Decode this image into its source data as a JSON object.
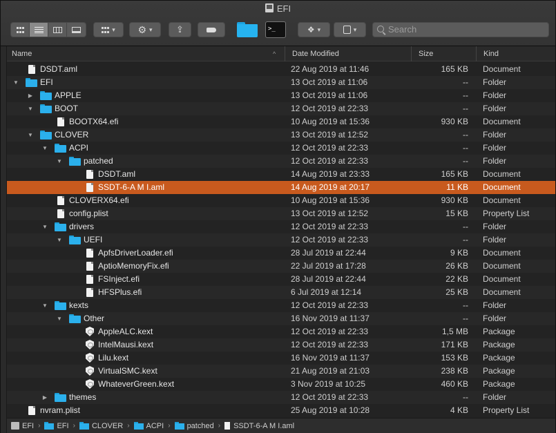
{
  "window": {
    "title": "EFI"
  },
  "toolbar": {
    "view_modes": [
      "icon-view",
      "list-view",
      "column-view",
      "gallery-view"
    ],
    "selected_view": "list-view",
    "search_placeholder": "Search"
  },
  "columns": {
    "name": "Name",
    "date": "Date Modified",
    "size": "Size",
    "kind": "Kind"
  },
  "rows": [
    {
      "level": 0,
      "disclosure": "",
      "icon": "document",
      "name": "DSDT.aml",
      "date": "22 Aug 2019 at 11:46",
      "size": "165 KB",
      "kind": "Document"
    },
    {
      "level": 0,
      "disclosure": "open",
      "icon": "folder",
      "name": "EFI",
      "date": "13 Oct 2019 at 11:06",
      "size": "--",
      "kind": "Folder"
    },
    {
      "level": 1,
      "disclosure": "closed",
      "icon": "folder",
      "name": "APPLE",
      "date": "13 Oct 2019 at 11:06",
      "size": "--",
      "kind": "Folder"
    },
    {
      "level": 1,
      "disclosure": "open",
      "icon": "folder",
      "name": "BOOT",
      "date": "12 Oct 2019 at 22:33",
      "size": "--",
      "kind": "Folder"
    },
    {
      "level": 2,
      "disclosure": "",
      "icon": "document",
      "name": "BOOTX64.efi",
      "date": "10 Aug 2019 at 15:36",
      "size": "930 KB",
      "kind": "Document"
    },
    {
      "level": 1,
      "disclosure": "open",
      "icon": "folder",
      "name": "CLOVER",
      "date": "13 Oct 2019 at 12:52",
      "size": "--",
      "kind": "Folder"
    },
    {
      "level": 2,
      "disclosure": "open",
      "icon": "folder",
      "name": "ACPI",
      "date": "12 Oct 2019 at 22:33",
      "size": "--",
      "kind": "Folder"
    },
    {
      "level": 3,
      "disclosure": "open",
      "icon": "folder",
      "name": "patched",
      "date": "12 Oct 2019 at 22:33",
      "size": "--",
      "kind": "Folder"
    },
    {
      "level": 4,
      "disclosure": "",
      "icon": "document",
      "name": "DSDT.aml",
      "date": "14 Aug 2019 at 23:33",
      "size": "165 KB",
      "kind": "Document"
    },
    {
      "level": 4,
      "disclosure": "",
      "icon": "document",
      "name": "SSDT-6-A M I.aml",
      "date": "14 Aug 2019 at 20:17",
      "size": "11 KB",
      "kind": "Document",
      "selected": true
    },
    {
      "level": 2,
      "disclosure": "",
      "icon": "document",
      "name": "CLOVERX64.efi",
      "date": "10 Aug 2019 at 15:36",
      "size": "930 KB",
      "kind": "Document"
    },
    {
      "level": 2,
      "disclosure": "",
      "icon": "document",
      "name": "config.plist",
      "date": "13 Oct 2019 at 12:52",
      "size": "15 KB",
      "kind": "Property List"
    },
    {
      "level": 2,
      "disclosure": "open",
      "icon": "folder",
      "name": "drivers",
      "date": "12 Oct 2019 at 22:33",
      "size": "--",
      "kind": "Folder"
    },
    {
      "level": 3,
      "disclosure": "open",
      "icon": "folder",
      "name": "UEFI",
      "date": "12 Oct 2019 at 22:33",
      "size": "--",
      "kind": "Folder"
    },
    {
      "level": 4,
      "disclosure": "",
      "icon": "document",
      "name": "ApfsDriverLoader.efi",
      "date": "28 Jul 2019 at 22:44",
      "size": "9 KB",
      "kind": "Document"
    },
    {
      "level": 4,
      "disclosure": "",
      "icon": "document",
      "name": "AptioMemoryFix.efi",
      "date": "22 Jul 2019 at 17:28",
      "size": "26 KB",
      "kind": "Document"
    },
    {
      "level": 4,
      "disclosure": "",
      "icon": "document",
      "name": "FSInject.efi",
      "date": "28 Jul 2019 at 22:44",
      "size": "22 KB",
      "kind": "Document"
    },
    {
      "level": 4,
      "disclosure": "",
      "icon": "document",
      "name": "HFSPlus.efi",
      "date": "6 Jul 2019 at 12:14",
      "size": "25 KB",
      "kind": "Document"
    },
    {
      "level": 2,
      "disclosure": "open",
      "icon": "folder",
      "name": "kexts",
      "date": "12 Oct 2019 at 22:33",
      "size": "--",
      "kind": "Folder"
    },
    {
      "level": 3,
      "disclosure": "open",
      "icon": "folder",
      "name": "Other",
      "date": "16 Nov 2019 at 11:37",
      "size": "--",
      "kind": "Folder"
    },
    {
      "level": 4,
      "disclosure": "",
      "icon": "kext",
      "name": "AppleALC.kext",
      "date": "12 Oct 2019 at 22:33",
      "size": "1,5 MB",
      "kind": "Package"
    },
    {
      "level": 4,
      "disclosure": "",
      "icon": "kext",
      "name": "IntelMausi.kext",
      "date": "12 Oct 2019 at 22:33",
      "size": "171 KB",
      "kind": "Package"
    },
    {
      "level": 4,
      "disclosure": "",
      "icon": "kext",
      "name": "Lilu.kext",
      "date": "16 Nov 2019 at 11:37",
      "size": "153 KB",
      "kind": "Package"
    },
    {
      "level": 4,
      "disclosure": "",
      "icon": "kext",
      "name": "VirtualSMC.kext",
      "date": "21 Aug 2019 at 21:03",
      "size": "238 KB",
      "kind": "Package"
    },
    {
      "level": 4,
      "disclosure": "",
      "icon": "kext",
      "name": "WhateverGreen.kext",
      "date": "3 Nov 2019 at 10:25",
      "size": "460 KB",
      "kind": "Package"
    },
    {
      "level": 2,
      "disclosure": "closed",
      "icon": "folder",
      "name": "themes",
      "date": "12 Oct 2019 at 22:33",
      "size": "--",
      "kind": "Folder"
    },
    {
      "level": 0,
      "disclosure": "",
      "icon": "document",
      "name": "nvram.plist",
      "date": "25 Aug 2019 at 10:28",
      "size": "4 KB",
      "kind": "Property List"
    }
  ],
  "pathbar": [
    {
      "icon": "disk",
      "label": "EFI"
    },
    {
      "icon": "folder",
      "label": "EFI"
    },
    {
      "icon": "folder",
      "label": "CLOVER"
    },
    {
      "icon": "folder",
      "label": "ACPI"
    },
    {
      "icon": "folder",
      "label": "patched"
    },
    {
      "icon": "document",
      "label": "SSDT-6-A M I.aml"
    }
  ],
  "colors": {
    "selection": "#c85a1e",
    "folder": "#2bb0ec",
    "background": "#232323"
  }
}
